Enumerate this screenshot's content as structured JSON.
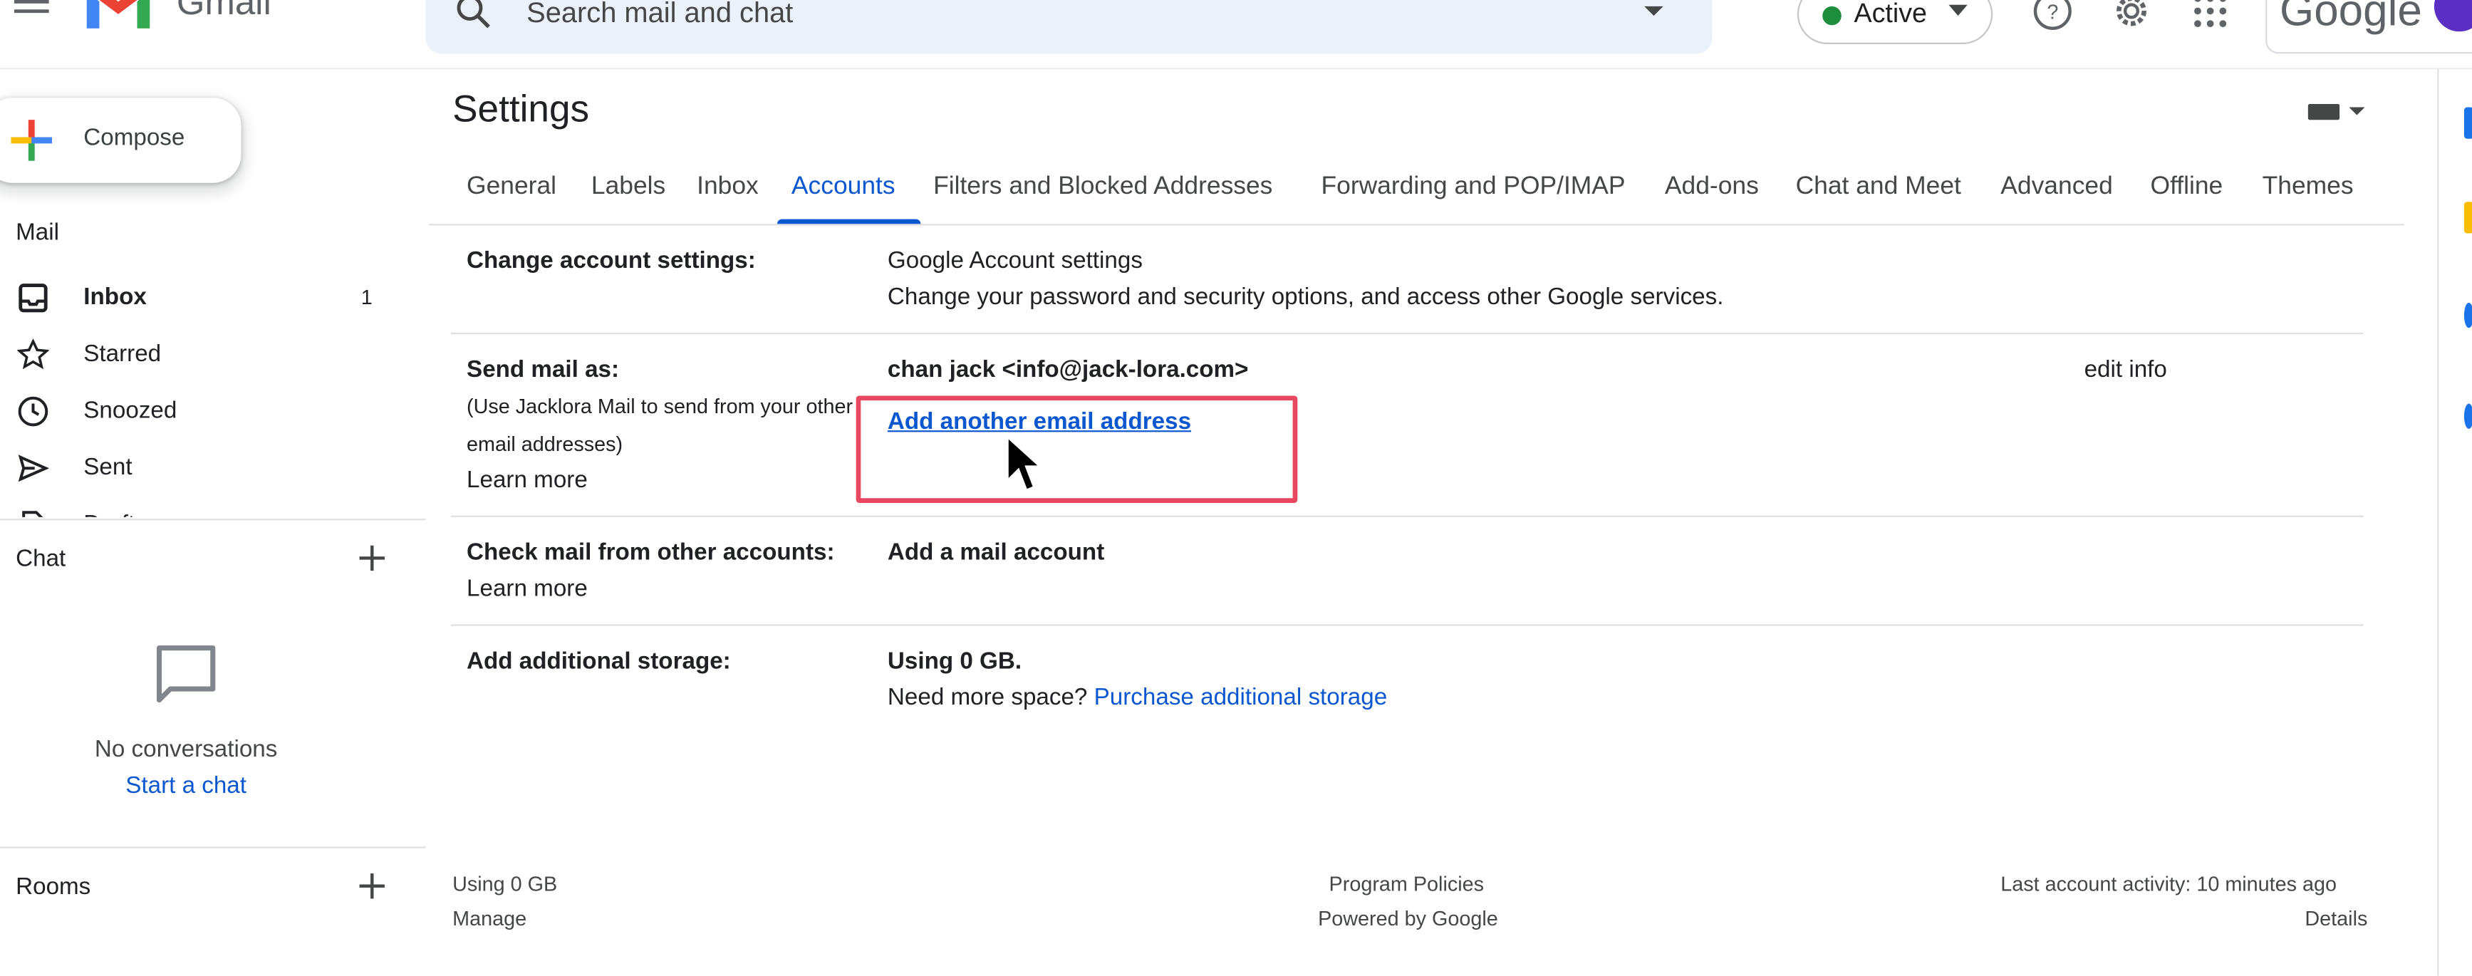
{
  "header": {
    "app_name": "Gmail",
    "search_placeholder": "Search mail and chat",
    "status": "Active",
    "status_color": "#1e8e3e",
    "brand_word": "Google",
    "icons": [
      "menu-icon",
      "search-icon",
      "help-icon",
      "settings-gear-icon",
      "apps-grid-icon"
    ]
  },
  "nav": {
    "compose_label": "Compose",
    "mail_section": "Mail",
    "items": [
      {
        "label": "Inbox",
        "count": "1",
        "icon": "inbox-icon"
      },
      {
        "label": "Starred",
        "icon": "star-icon"
      },
      {
        "label": "Snoozed",
        "icon": "clock-icon"
      },
      {
        "label": "Sent",
        "icon": "send-icon"
      },
      {
        "label": "Drafts",
        "icon": "draft-icon"
      }
    ],
    "chat_section": "Chat",
    "chat_empty_text": "No conversations",
    "start_chat_link": "Start a chat",
    "rooms_section": "Rooms"
  },
  "settings": {
    "title": "Settings",
    "tabs": [
      "General",
      "Labels",
      "Inbox",
      "Accounts",
      "Filters and Blocked Addresses",
      "Forwarding and POP/IMAP",
      "Add-ons",
      "Chat and Meet",
      "Advanced",
      "Offline",
      "Themes"
    ],
    "active_tab": "Accounts",
    "accent_color": "#0b57d0",
    "rows": {
      "change_account": {
        "label": "Change account settings:",
        "link": "Google Account settings",
        "description": "Change your password and security options, and access other Google services."
      },
      "send_mail_as": {
        "label": "Send mail as:",
        "note": "(Use Jacklora Mail to send from your other email addresses)",
        "learn_more": "Learn more",
        "address": "chan jack <info@jack-lora.com>",
        "edit_info": "edit info",
        "add_address": "Add another email address"
      },
      "check_mail": {
        "label": "Check mail from other accounts:",
        "learn_more": "Learn more",
        "add_account": "Add a mail account"
      },
      "storage": {
        "label": "Add additional storage:",
        "usage": "Using 0 GB.",
        "need_more": "Need more space?",
        "purchase_link": "Purchase additional storage"
      }
    },
    "highlight_color": "#e8485f"
  },
  "footer": {
    "usage": "Using 0 GB",
    "manage": "Manage",
    "program_policies": "Program Policies",
    "powered_by": "Powered by Google",
    "last_activity": "Last account activity: 10 minutes ago",
    "details": "Details"
  }
}
